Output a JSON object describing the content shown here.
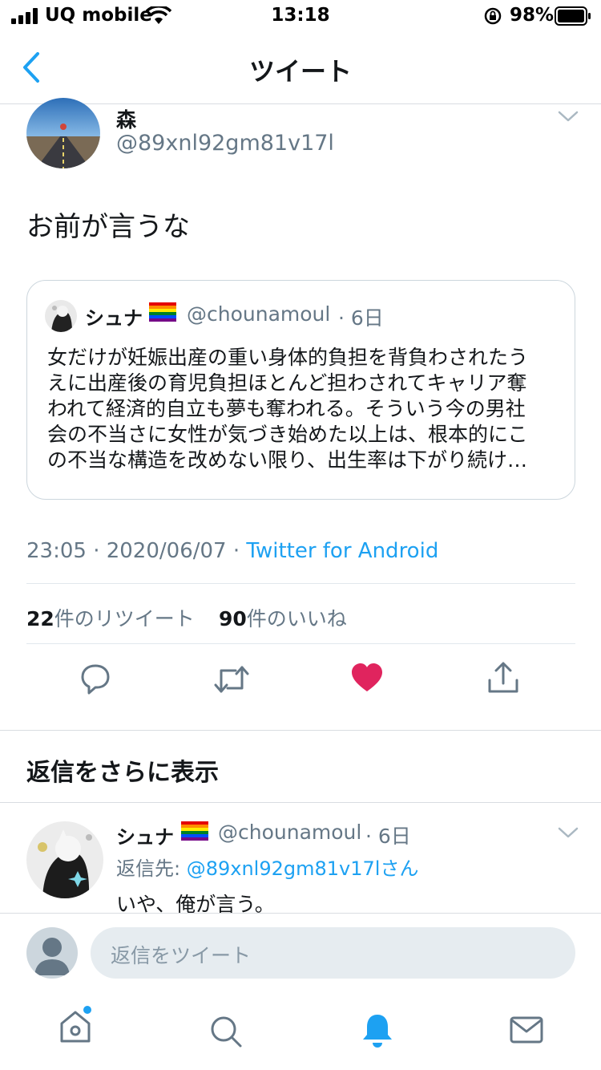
{
  "status_bar": {
    "carrier": "UQ mobile",
    "time": "13:18",
    "battery": "98%"
  },
  "nav": {
    "title": "ツイート"
  },
  "tweet": {
    "name": "森",
    "handle": "@89xnl92gm81v17l",
    "text": "お前が言うな",
    "timestamp": "23:05 · 2020/06/07 · ",
    "source": "Twitter for Android",
    "retweet_count": "22",
    "retweet_label": "件のリツイート",
    "like_count": "90",
    "like_label": "件のいいね",
    "liked": true
  },
  "quote": {
    "name": "シュナ",
    "flag": "🏳️‍🌈",
    "handle": "@chounamoul",
    "time": "· 6日",
    "lines": [
      "女だけが妊娠出産の重い身体的負担を背負わされたう",
      "えに出産後の育児負担ほとんど担わされてキャリア奪",
      "われて経済的自立も夢も奪われる。そういう今の男社",
      "会の不当さに女性が気づき始めた以上は、根本的にこ",
      "の不当な構造を改めない限り、出生率は下がり続け…"
    ]
  },
  "more_replies": {
    "title": "返信をさらに表示"
  },
  "reply": {
    "name": "シュナ",
    "handle": "@chounamoul",
    "time": "· 6日",
    "reply_to_prefix": "返信先: ",
    "reply_to_handle": "@89xnl92gm81v17lさん",
    "text": "いや、俺が言う。"
  },
  "compose": {
    "placeholder": "返信をツイート"
  },
  "colors": {
    "accent": "#1da1f2",
    "like": "#e0245e",
    "secondary_text": "#657786"
  },
  "icons": {
    "back": "chevron-left-icon",
    "caret": "chevron-down-icon",
    "reply": "comment-icon",
    "retweet": "retweet-icon",
    "like": "heart-icon",
    "share": "share-icon",
    "home": "home-icon",
    "search": "search-icon",
    "notifications": "bell-icon",
    "messages": "mail-icon"
  }
}
